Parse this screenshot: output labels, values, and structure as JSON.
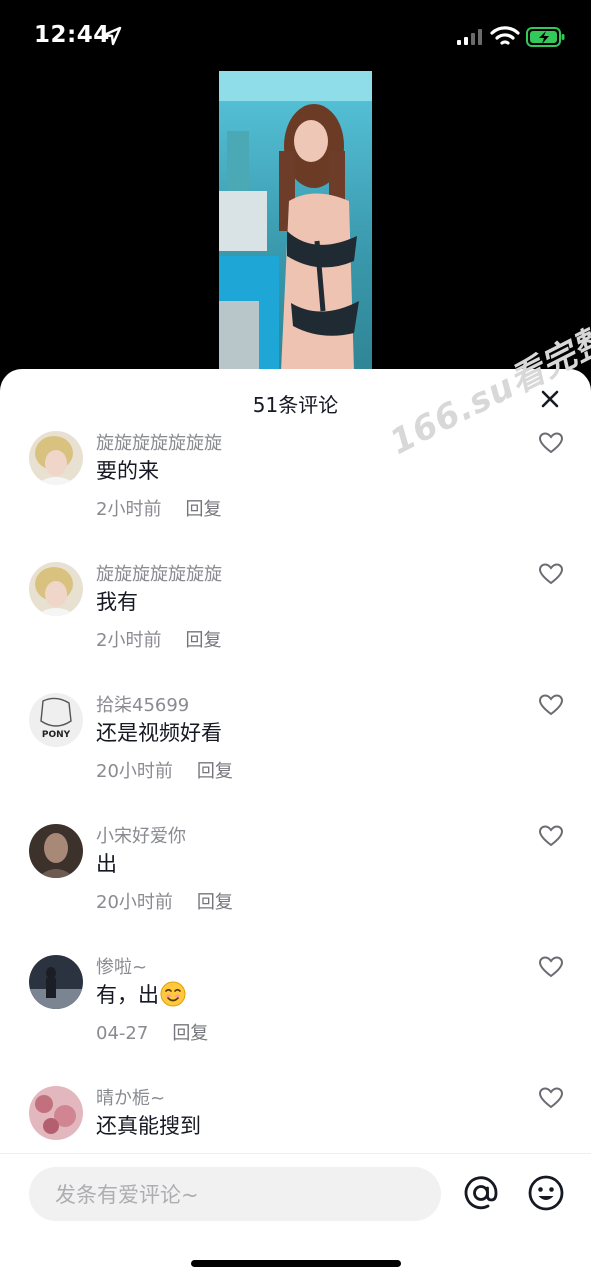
{
  "status_bar": {
    "time": "12:44"
  },
  "sheet": {
    "title": "51条评论",
    "comments": [
      {
        "user": "旋旋旋旋旋旋旋",
        "text": "要的来",
        "time": "2小时前",
        "reply": "回复",
        "avatar_color": "#c9b68a"
      },
      {
        "user": "旋旋旋旋旋旋旋",
        "text": "我有",
        "time": "2小时前",
        "reply": "回复",
        "avatar_color": "#c9b68a"
      },
      {
        "user": "拾柒45699",
        "text": "还是视频好看",
        "time": "20小时前",
        "reply": "回复",
        "avatar_color": "#eeeeee",
        "avatar_text": "PONY"
      },
      {
        "user": "小宋好爱你",
        "text": "出",
        "time": "20小时前",
        "reply": "回复",
        "avatar_color": "#5a4a44"
      },
      {
        "user": "惨啦~",
        "text": "有，出",
        "time": "04-27",
        "reply": "回复",
        "avatar_color": "#3b4250"
      },
      {
        "user": "晴か栀~",
        "text": "还真能搜到",
        "avatar_color": "#d7a4ad"
      }
    ]
  },
  "watermark": "166.su看完整版",
  "input": {
    "placeholder": "发条有爱评论~"
  },
  "icons": {
    "location": "location-arrow-icon",
    "signal": "cellular-signal-icon",
    "wifi": "wifi-icon",
    "battery": "battery-charging-icon",
    "close": "close-icon",
    "like": "heart-outline-icon",
    "mention": "at-sign-icon",
    "emoji": "smiley-icon"
  },
  "colors": {
    "battery_green": "#34c759",
    "text_primary": "#161823",
    "text_secondary": "#8a8b91"
  }
}
